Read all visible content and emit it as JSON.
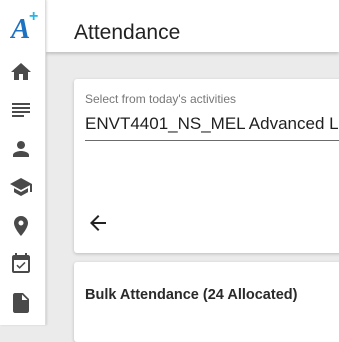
{
  "sidebar": {
    "logo_icon": "app-logo-a-plus-icon",
    "logo_color": "#1d72c2",
    "items": [
      {
        "name": "home",
        "icon": "home-icon"
      },
      {
        "name": "list",
        "icon": "list-icon"
      },
      {
        "name": "person",
        "icon": "person-icon"
      },
      {
        "name": "school",
        "icon": "graduation-cap-icon"
      },
      {
        "name": "location",
        "icon": "location-pin-icon"
      },
      {
        "name": "calendar",
        "icon": "calendar-check-icon"
      },
      {
        "name": "document",
        "icon": "document-icon"
      }
    ]
  },
  "header": {
    "title": "Attendance"
  },
  "activity_select": {
    "label": "Select from today's activities",
    "value": "ENVT4401_NS_MEL Advanced L"
  },
  "back_icon": "arrow-back-icon",
  "bulk": {
    "title": "Bulk Attendance (24 Allocated)"
  }
}
